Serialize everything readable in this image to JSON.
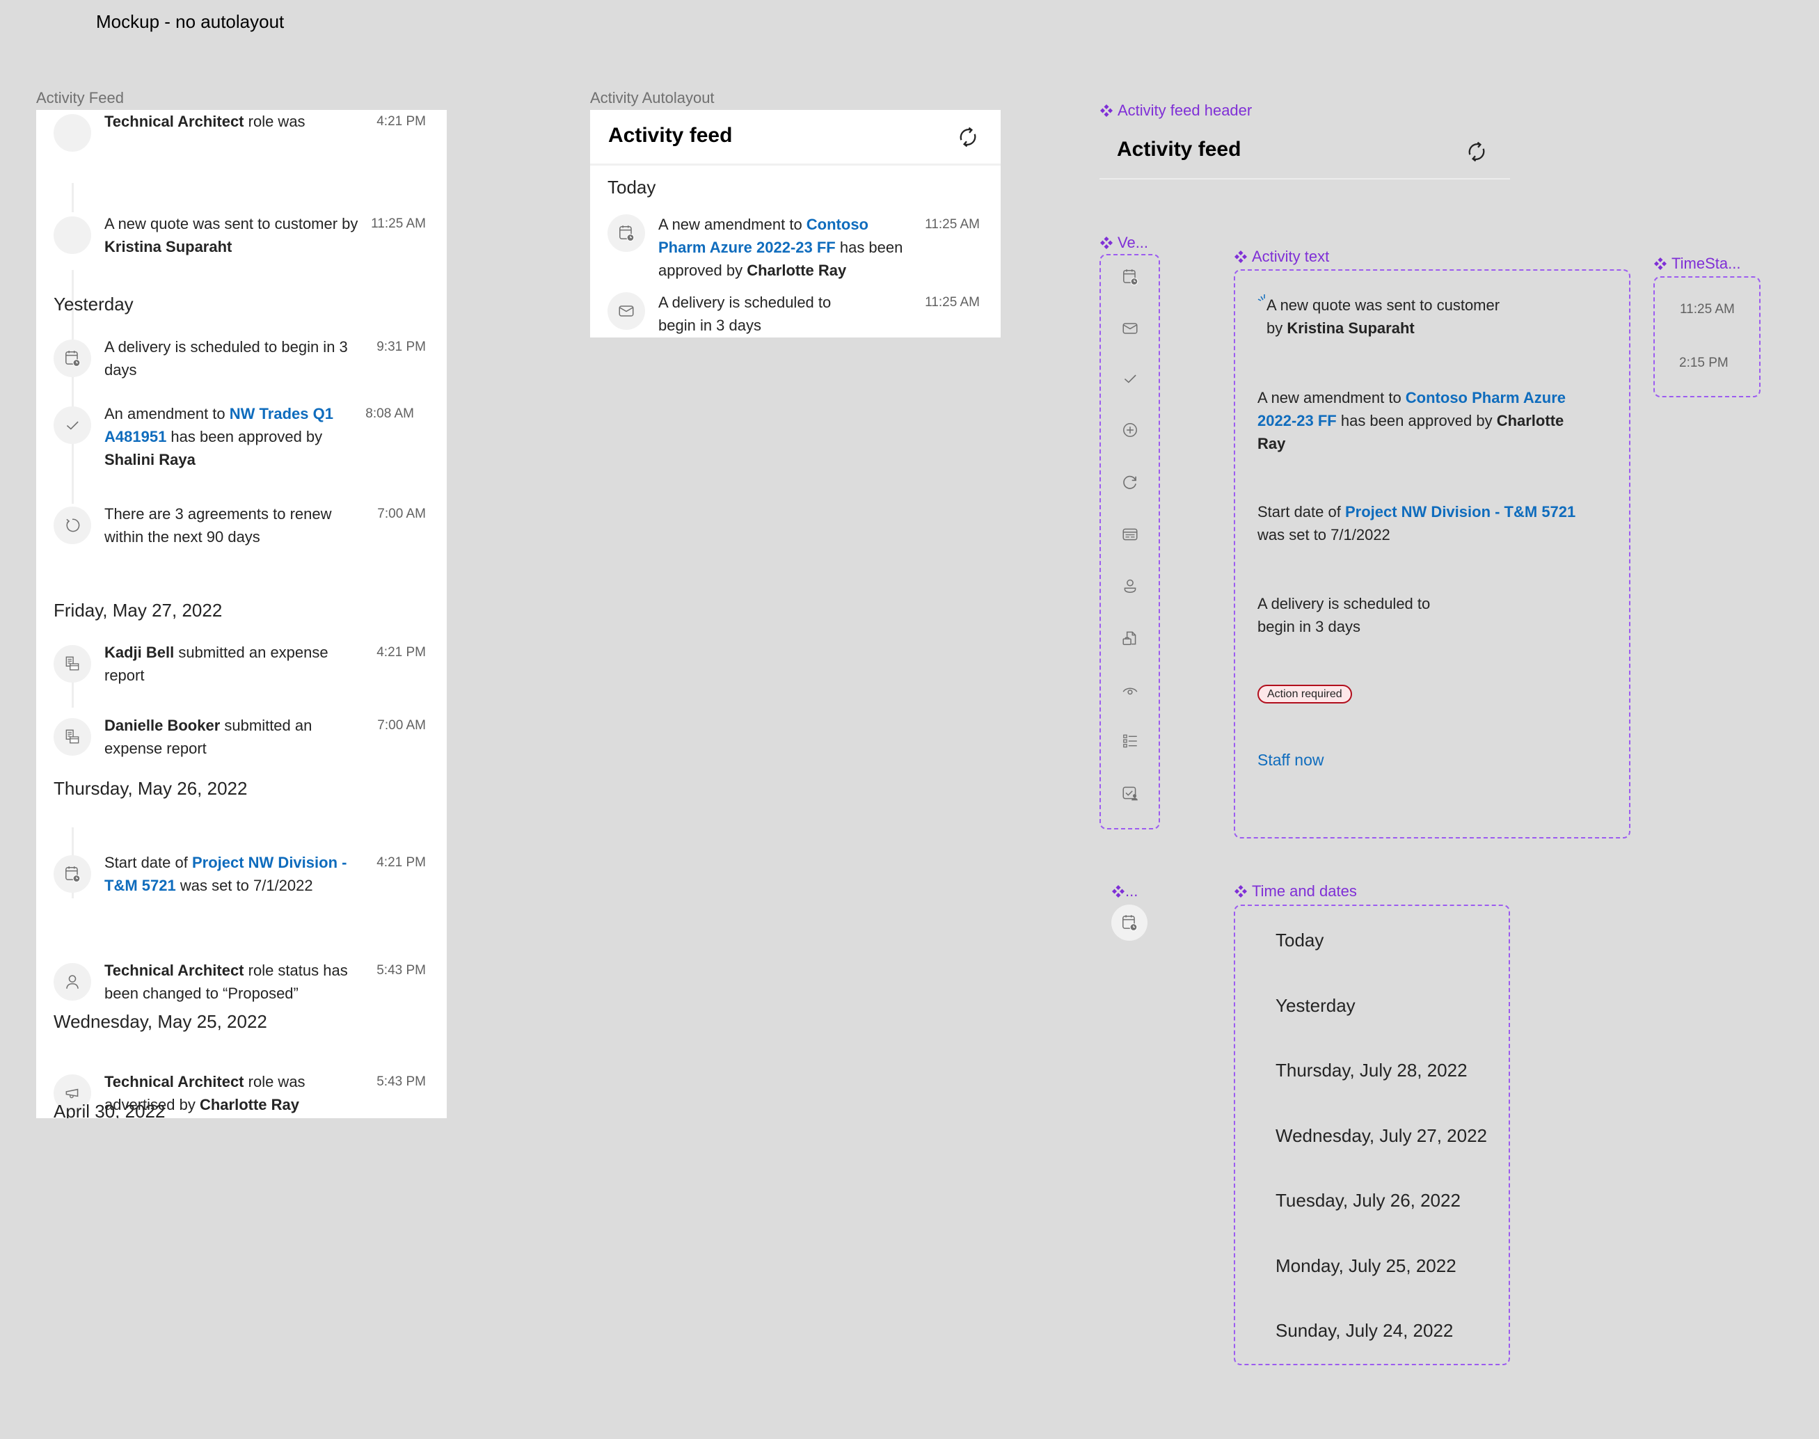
{
  "page_title": "Mockup - no autolayout",
  "colors": {
    "canvas": "#dcdcdc",
    "link": "#0f6cbd",
    "component_purple": "#7f2fd6",
    "badge_border": "#b10e1c",
    "badge_fill": "#fde7e9",
    "icon_circle": "#f1f1f1"
  },
  "activity_feed_frame": {
    "label": "Activity Feed",
    "items": [
      {
        "icon": "blank-circle",
        "segments": [
          {
            "t": "A new quote was sent to customer by ",
            "s": "normal"
          },
          {
            "t": "Kristina Suparaht",
            "s": "bold"
          }
        ],
        "time": "11:25 AM"
      },
      {
        "date_header": "Yesterday"
      },
      {
        "icon": "calendar-clock-icon",
        "segments": [
          {
            "t": "A delivery is scheduled to begin in 3 days",
            "s": "normal"
          }
        ],
        "time": "9:31 PM"
      },
      {
        "icon": "checkmark-icon",
        "segments": [
          {
            "t": "An amendment to ",
            "s": "normal"
          },
          {
            "t": "NW Trades Q1 A481951",
            "s": "link"
          },
          {
            "t": " has been approved by ",
            "s": "normal"
          },
          {
            "t": "Shalini Raya",
            "s": "bold"
          }
        ],
        "time": "8:08 AM"
      },
      {
        "icon": "renew-icon",
        "segments": [
          {
            "t": "There are 3 agreements to renew within the next 90 days",
            "s": "normal"
          }
        ],
        "time": "7:00 AM"
      },
      {
        "date_header": "Friday, May 27, 2022"
      },
      {
        "icon": "expense-report-icon",
        "segments": [
          {
            "t": "Kadji Bell",
            "s": "bold"
          },
          {
            "t": " submitted an expense report",
            "s": "normal"
          }
        ],
        "time": "4:21 PM"
      },
      {
        "icon": "expense-report-icon",
        "segments": [
          {
            "t": "Danielle Booker",
            "s": "bold"
          },
          {
            "t": " submitted an expense report",
            "s": "normal"
          }
        ],
        "time": "7:00 AM"
      },
      {
        "date_header": "Thursday, May 26, 2022"
      },
      {
        "icon": "calendar-clock-icon",
        "segments": [
          {
            "t": "Start date of ",
            "s": "normal"
          },
          {
            "t": "Project NW Division - T&M 5721",
            "s": "link"
          },
          {
            "t": " was set to 7/1/2022",
            "s": "normal"
          }
        ],
        "time": "4:21 PM"
      },
      {
        "icon": "person-icon",
        "segments": [
          {
            "t": "Technical Architect",
            "s": "bold"
          },
          {
            "t": " role status has been changed to “Proposed”",
            "s": "normal"
          }
        ],
        "time": "5:43 PM"
      },
      {
        "date_header": "Wednesday, May 25, 2022"
      },
      {
        "icon": "megaphone-icon",
        "segments": [
          {
            "t": "Technical Architect",
            "s": "bold"
          },
          {
            "t": " role was advertised by ",
            "s": "normal"
          },
          {
            "t": "Charlotte Ray",
            "s": "bold"
          }
        ],
        "time": "5:43 PM"
      },
      {
        "date_header": "April 30, 2022"
      },
      {
        "icon": "blank-circle",
        "segments": [
          {
            "t": "Technical Architect",
            "s": "bold"
          },
          {
            "t": " role was",
            "s": "normal"
          }
        ],
        "time": "4:21 PM"
      }
    ]
  },
  "activity_autolayout_frame": {
    "label": "Activity Autolayout",
    "header_title": "Activity feed",
    "refresh_icon": "refresh-icon",
    "date_header": "Today",
    "items": [
      {
        "icon": "calendar-clock-icon",
        "segments": [
          {
            "t": "A new amendment to ",
            "s": "normal"
          },
          {
            "t": "Contoso Pharm Azure 2022-23 FF",
            "s": "link"
          },
          {
            "t": " has been approved by ",
            "s": "normal"
          },
          {
            "t": "Charlotte Ray",
            "s": "bold"
          }
        ],
        "time": "11:25 AM"
      },
      {
        "icon": "mail-icon",
        "segments": [
          {
            "t": "A delivery is scheduled to begin in 3 days",
            "s": "normal"
          }
        ],
        "time": "11:25 AM"
      }
    ]
  },
  "components": {
    "header_component": {
      "label": "Activity feed header",
      "title": "Activity feed",
      "refresh_icon": "refresh-icon"
    },
    "icon_variants": {
      "label": "Ve...",
      "icons": [
        "calendar-clock-icon",
        "mail-icon",
        "checkmark-icon",
        "add-circle-icon",
        "refresh-arrow-icon",
        "card-text-icon",
        "person-icon",
        "document-briefcase-icon",
        "eye-icon",
        "list-icon",
        "checkbox-person-icon"
      ]
    },
    "activity_text": {
      "label": "Activity text",
      "entries": [
        {
          "segments": [
            {
              "t": "A new quote was sent to customer",
              "s": "normal"
            },
            {
              "t": "\n",
              "s": "br"
            },
            {
              "t": "by ",
              "s": "normal"
            },
            {
              "t": "Kristina Suparaht",
              "s": "bold"
            }
          ]
        },
        {
          "segments": [
            {
              "t": "A new amendment to ",
              "s": "normal"
            },
            {
              "t": "Contoso Pharm Azure 2022-23 FF",
              "s": "link"
            },
            {
              "t": " has been approved by ",
              "s": "normal"
            },
            {
              "t": "Charlotte Ray",
              "s": "bold"
            }
          ]
        },
        {
          "segments": [
            {
              "t": "Start date of ",
              "s": "normal"
            },
            {
              "t": "Project NW Division - T&M 5721",
              "s": "link"
            },
            {
              "t": " was set to 7/1/2022",
              "s": "normal"
            }
          ]
        },
        {
          "segments": [
            {
              "t": "A delivery is scheduled to",
              "s": "normal"
            },
            {
              "t": "\n",
              "s": "br"
            },
            {
              "t": "begin in 3 days",
              "s": "normal"
            }
          ]
        }
      ],
      "badge": "Action required",
      "action_link": "Staff now"
    },
    "timestamps": {
      "label": "TimeSta...",
      "values": [
        "11:25 AM",
        "2:15 PM"
      ]
    },
    "icon_circle": {
      "label": "...",
      "icon": "calendar-clock-icon"
    },
    "time_and_dates": {
      "label": "Time and dates",
      "values": [
        "Today",
        "Yesterday",
        "Thursday, July 28, 2022",
        "Wednesday, July 27, 2022",
        "Tuesday, July 26, 2022",
        "Monday, July 25, 2022",
        "Sunday, July 24, 2022"
      ]
    }
  }
}
